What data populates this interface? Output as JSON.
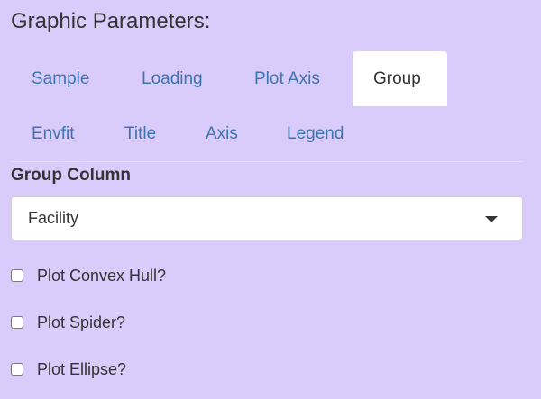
{
  "heading": "Graphic Parameters:",
  "tabs": [
    {
      "label": "Sample",
      "active": false
    },
    {
      "label": "Loading",
      "active": false
    },
    {
      "label": "Plot Axis",
      "active": false
    },
    {
      "label": "Group",
      "active": true
    },
    {
      "label": "Envfit",
      "active": false
    },
    {
      "label": "Title",
      "active": false
    },
    {
      "label": "Axis",
      "active": false
    },
    {
      "label": "Legend",
      "active": false
    }
  ],
  "group_column": {
    "label": "Group Column",
    "selected": "Facility"
  },
  "options": [
    {
      "label": "Plot Convex Hull?",
      "checked": false
    },
    {
      "label": "Plot Spider?",
      "checked": false
    },
    {
      "label": "Plot Ellipse?",
      "checked": false
    }
  ],
  "colors": {
    "background": "#d9ccfb",
    "tab_link": "#3d74b0",
    "active_tab_bg": "#ffffff",
    "text": "#333333"
  }
}
